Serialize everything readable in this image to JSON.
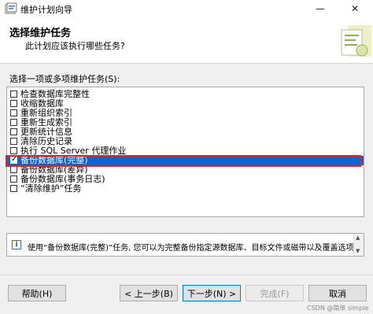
{
  "window": {
    "title": "维护计划向导",
    "minimize_glyph": "—",
    "close_glyph": "✕"
  },
  "header": {
    "title": "选择维护任务",
    "subtitle": "此计划应该执行哪些任务?"
  },
  "tasks": {
    "label": "选择一项或多项维护任务(S):",
    "items": [
      {
        "label": "检查数据库完整性",
        "checked": false
      },
      {
        "label": "收缩数据库",
        "checked": false
      },
      {
        "label": "重新组织索引",
        "checked": false
      },
      {
        "label": "重新生成索引",
        "checked": false
      },
      {
        "label": "更新统计信息",
        "checked": false
      },
      {
        "label": "清除历史记录",
        "checked": false
      },
      {
        "label": "执行 SQL Server 代理作业",
        "checked": false
      },
      {
        "label": "备份数据库(完整)",
        "checked": true
      },
      {
        "label": "备份数据库(差异)",
        "checked": false
      },
      {
        "label": "备份数据库(事务日志)",
        "checked": false
      },
      {
        "label": "“清除维护”任务",
        "checked": false
      }
    ]
  },
  "description": {
    "text": "使用“备份数据库(完整)”任务, 您可以为完整备份指定源数据库、目标文件或磁带以及覆盖选项。"
  },
  "buttons": {
    "help": "帮助(H)",
    "back": "< 上一步(B)",
    "next": "下一步(N) >",
    "finish": "完成(F)",
    "cancel": "取消"
  },
  "watermark": "CSDN @简单 simple"
}
